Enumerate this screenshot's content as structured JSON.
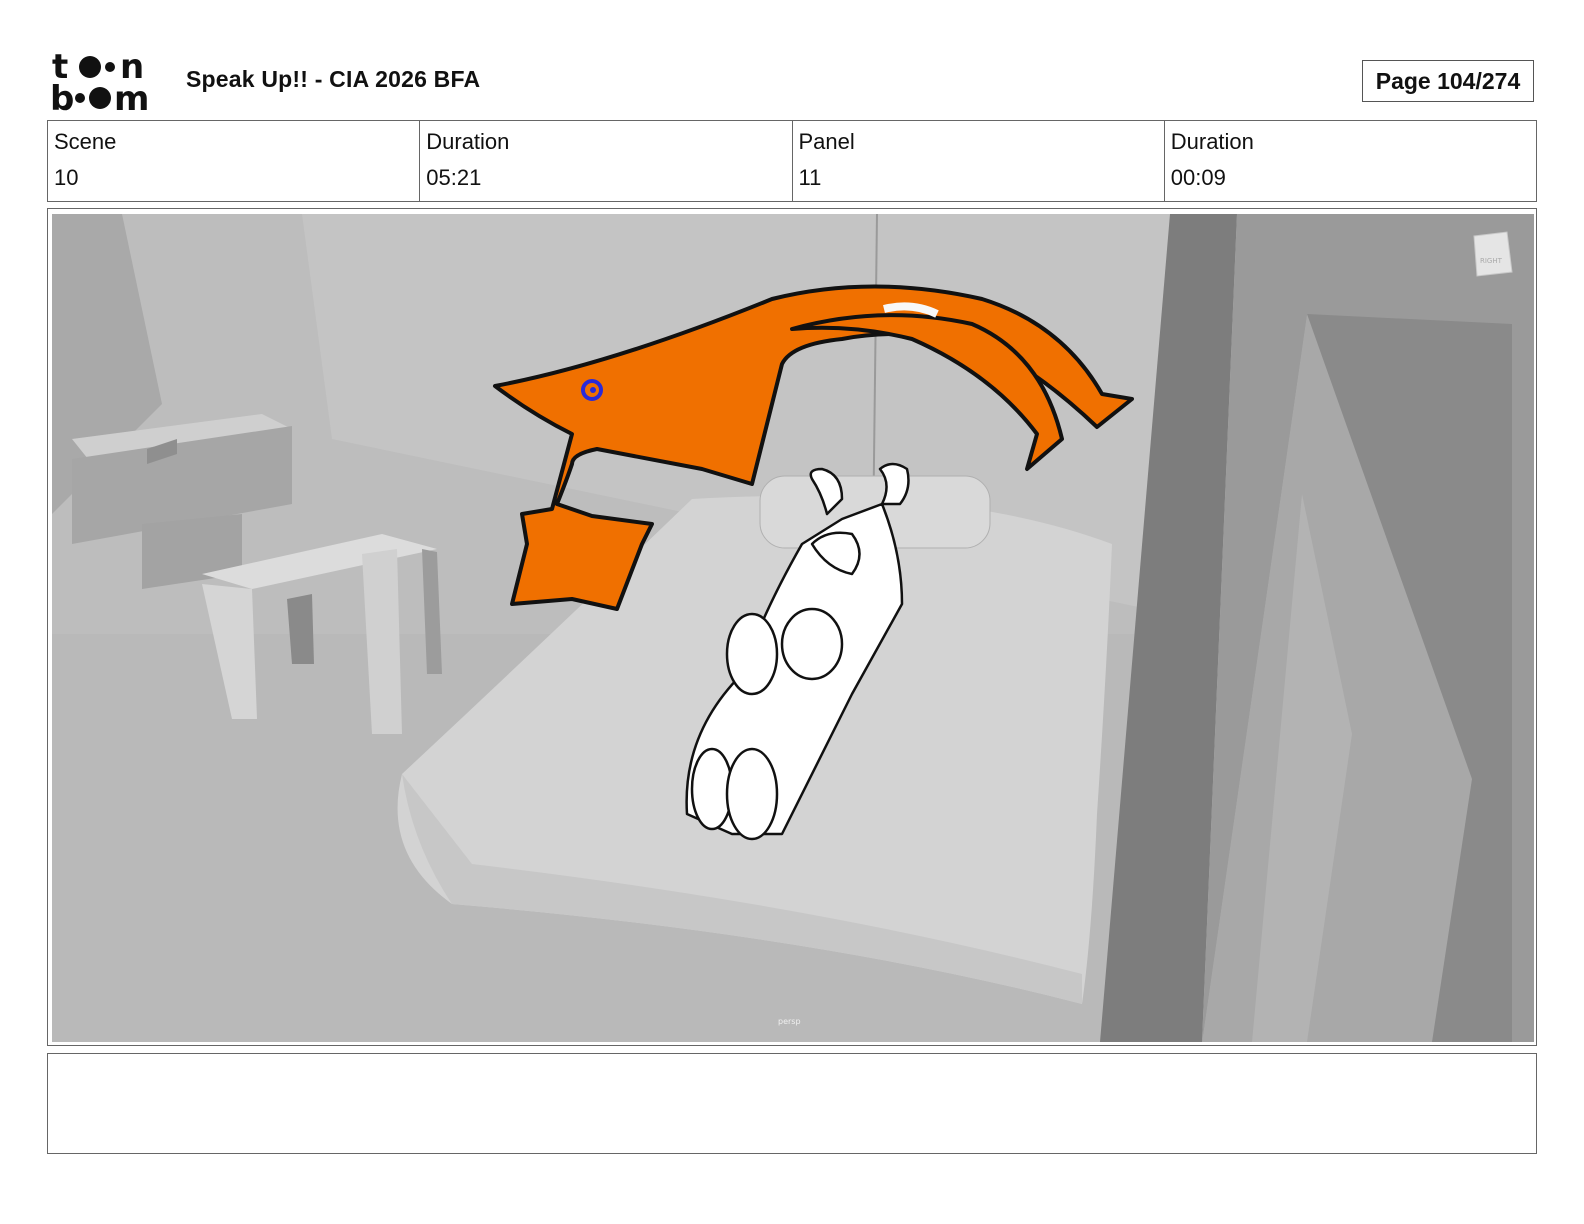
{
  "header": {
    "logo_top": "toon",
    "logo_bottom": "boom",
    "title": "Speak Up!! - CIA 2026 BFA",
    "page": "Page 104/274"
  },
  "info": {
    "scene_label": "Scene",
    "scene_value": "10",
    "scene_duration_label": "Duration",
    "scene_duration_value": "05:21",
    "panel_label": "Panel",
    "panel_value": "11",
    "panel_duration_label": "Duration",
    "panel_duration_value": "00:09"
  },
  "panel": {
    "camera_label": "persp",
    "corner_widget_label": "RIGHT",
    "accent_color": "#f07000",
    "swirl_color": "#2a2ad8"
  },
  "notes": {
    "text": ""
  }
}
